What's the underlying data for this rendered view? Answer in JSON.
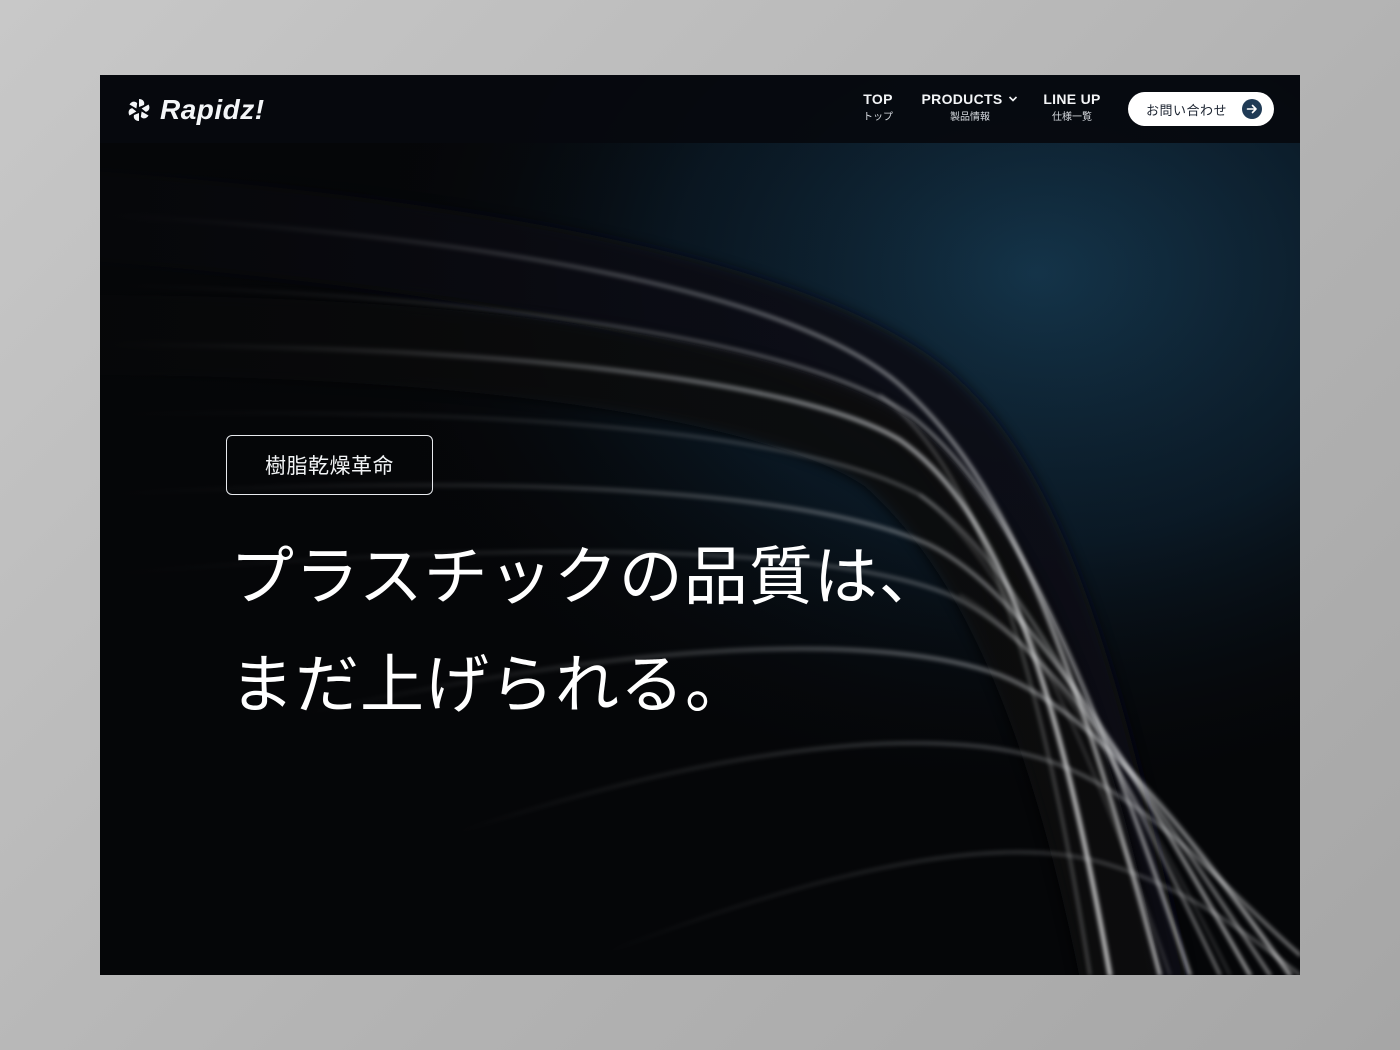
{
  "header": {
    "logo_text": "Rapidz!",
    "logo_icon": "turbine-icon",
    "nav": [
      {
        "label": "TOP",
        "sub": "トップ"
      },
      {
        "label": "PRODUCTS",
        "sub": "製品情報",
        "dropdown_icon": "chevron-down-icon"
      },
      {
        "label": "LINE UP",
        "sub": "仕様一覧"
      }
    ],
    "contact": {
      "label": "お問い合わせ",
      "icon": "arrow-right-icon"
    }
  },
  "hero": {
    "tag": "樹脂乾燥革命",
    "headline_lines": [
      "プラスチックの品質は、",
      "まだ上げられる。"
    ]
  },
  "colors": {
    "page_bg": "#b8b8b8",
    "hero_bg": "#050608",
    "hero_glow": "#123045",
    "accent": "#1f3a55",
    "text": "#ffffff"
  }
}
